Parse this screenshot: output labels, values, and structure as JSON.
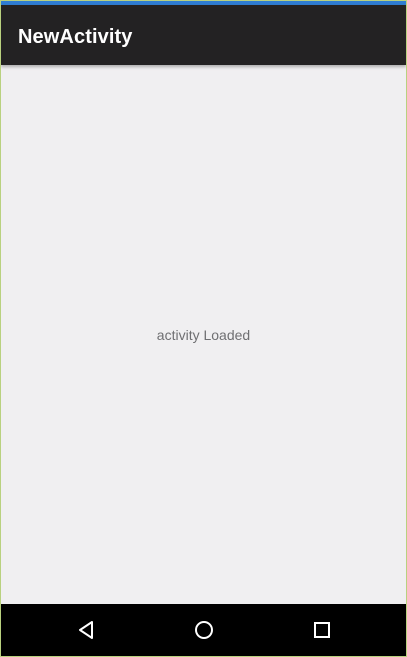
{
  "app_bar": {
    "title": "NewActivity"
  },
  "content": {
    "message": "activity Loaded"
  },
  "navigation": {
    "buttons": [
      {
        "name": "back",
        "icon": "back-triangle-icon"
      },
      {
        "name": "home",
        "icon": "home-circle-icon"
      },
      {
        "name": "recents",
        "icon": "recents-square-icon"
      }
    ]
  },
  "colors": {
    "status_strip": "#2f7dd2",
    "app_bar": "#232223",
    "content_background": "#f0eff1",
    "navigation_bar": "#000000"
  }
}
